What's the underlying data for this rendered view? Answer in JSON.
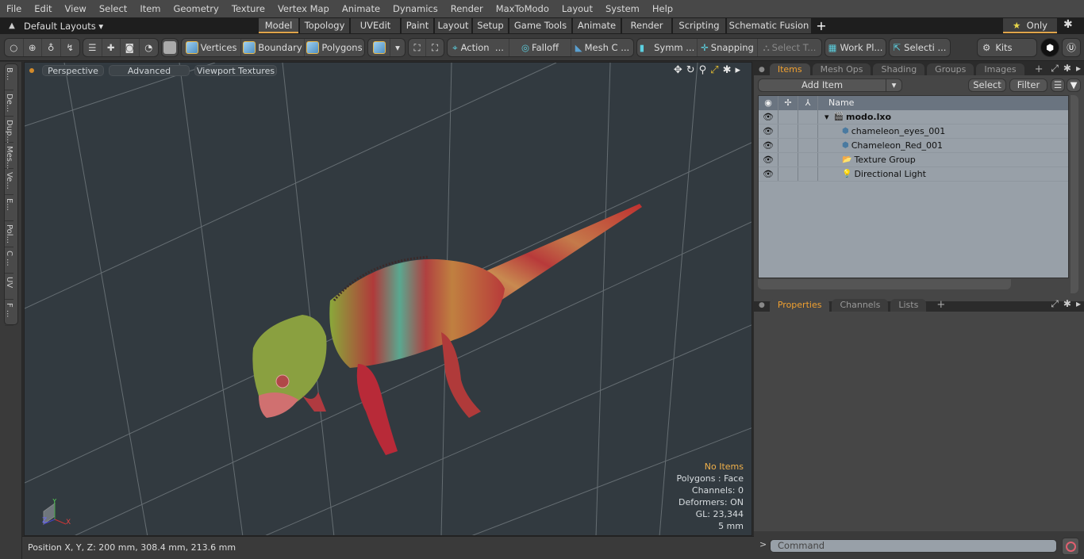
{
  "menu": [
    "File",
    "Edit",
    "View",
    "Select",
    "Item",
    "Geometry",
    "Texture",
    "Vertex Map",
    "Animate",
    "Dynamics",
    "Render",
    "MaxToModo",
    "Layout",
    "System",
    "Help"
  ],
  "layout_bar": {
    "default_layouts": "Default Layouts ▾",
    "tabs": [
      {
        "label": "Model",
        "active": true
      },
      {
        "label": "Topology"
      },
      {
        "label": "UVEdit"
      },
      {
        "label": "Paint"
      },
      {
        "label": "Layout"
      },
      {
        "label": "Setup"
      },
      {
        "label": "Game Tools"
      },
      {
        "label": "Animate"
      },
      {
        "label": "Render"
      },
      {
        "label": "Scripting"
      },
      {
        "label": "Schematic Fusion"
      }
    ],
    "add_tab": "+",
    "only_label": "Only",
    "star": "★"
  },
  "toolbar": {
    "vertices": "Vertices",
    "boundary": "Boundary",
    "polygons": "Polygons",
    "action": "Action",
    "falloff": "Falloff",
    "mesh_c": "Mesh C ...",
    "symm": "Symm ...",
    "snapping": "Snapping",
    "select_t": "Select T...",
    "work_pl": "Work Pl...",
    "selecti": "Selecti ...",
    "kits": "Kits",
    "ellipsis": "..."
  },
  "left_tabs": [
    "B...",
    "De...",
    "Dup...",
    "Mes...",
    "Ve...",
    "E...",
    "Pol...",
    "C ...",
    "UV",
    "F ..."
  ],
  "viewport": {
    "perspective": "Perspective",
    "advanced": "Advanced",
    "viewport_textures": "Viewport Textures",
    "hud": {
      "selection": "No Items",
      "polygons": "Polygons : Face",
      "channels": "Channels: 0",
      "deformers": "Deformers: ON",
      "gl": "GL: 23,344",
      "scale": "5 mm"
    },
    "axis": {
      "x": "X",
      "y": "Y",
      "z": "Z"
    }
  },
  "status_bar": {
    "position": "Position X, Y, Z:   200 mm, 308.4 mm, 213.6 mm"
  },
  "items_panel": {
    "tabs": [
      {
        "label": "Items",
        "active": true
      },
      {
        "label": "Mesh Ops"
      },
      {
        "label": "Shading"
      },
      {
        "label": "Groups"
      },
      {
        "label": "Images"
      }
    ],
    "add_item": "Add Item",
    "select": "Select",
    "filter": "Filter",
    "column_name": "Name",
    "rows": [
      {
        "name": "modo.lxo",
        "icon": "scene-icon",
        "bold": true,
        "expanded": true
      },
      {
        "name": "chameleon_eyes_001",
        "icon": "mesh-icon"
      },
      {
        "name": "Chameleon_Red_001",
        "icon": "mesh-icon"
      },
      {
        "name": "Texture Group",
        "icon": "folder-icon"
      },
      {
        "name": "Directional Light",
        "icon": "light-icon"
      }
    ]
  },
  "properties_panel": {
    "tabs": [
      {
        "label": "Properties",
        "active": true
      },
      {
        "label": "Channels"
      },
      {
        "label": "Lists"
      }
    ]
  },
  "command": {
    "prompt": ">",
    "placeholder": "Command"
  },
  "colors": {
    "accent": "#e0a44a",
    "hud_highlight": "#f0b04a",
    "viewport_bg": "#323a40"
  }
}
